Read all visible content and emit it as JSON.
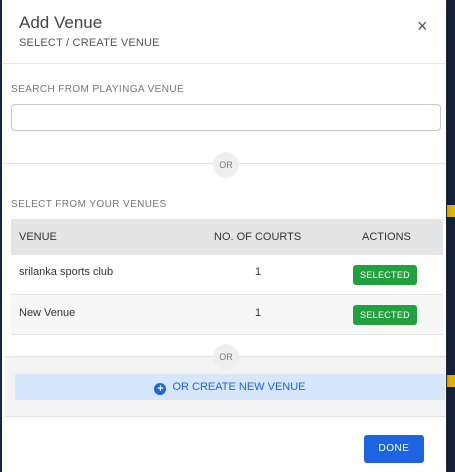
{
  "modal": {
    "title": "Add Venue",
    "subtitle": "SELECT / CREATE VENUE",
    "close_icon": "×"
  },
  "search": {
    "label": "SEARCH FROM PLAYINGA VENUE",
    "value": "",
    "placeholder": ""
  },
  "or_text": "OR",
  "venues": {
    "label": "SELECT FROM YOUR VENUES",
    "columns": [
      "VENUE",
      "NO. OF COURTS",
      "ACTIONS"
    ],
    "rows": [
      {
        "venue": "srilanka sports club",
        "courts": "1",
        "action": "SELECTED"
      },
      {
        "venue": "New Venue",
        "courts": "1",
        "action": "SELECTED"
      }
    ]
  },
  "create": {
    "label": "OR CREATE NEW VENUE",
    "icon": "plus-circle-icon"
  },
  "footer": {
    "done_label": "DONE"
  },
  "colors": {
    "primary": "#1d64e0",
    "success": "#21a03d",
    "create_bg": "#d6e6fb"
  }
}
